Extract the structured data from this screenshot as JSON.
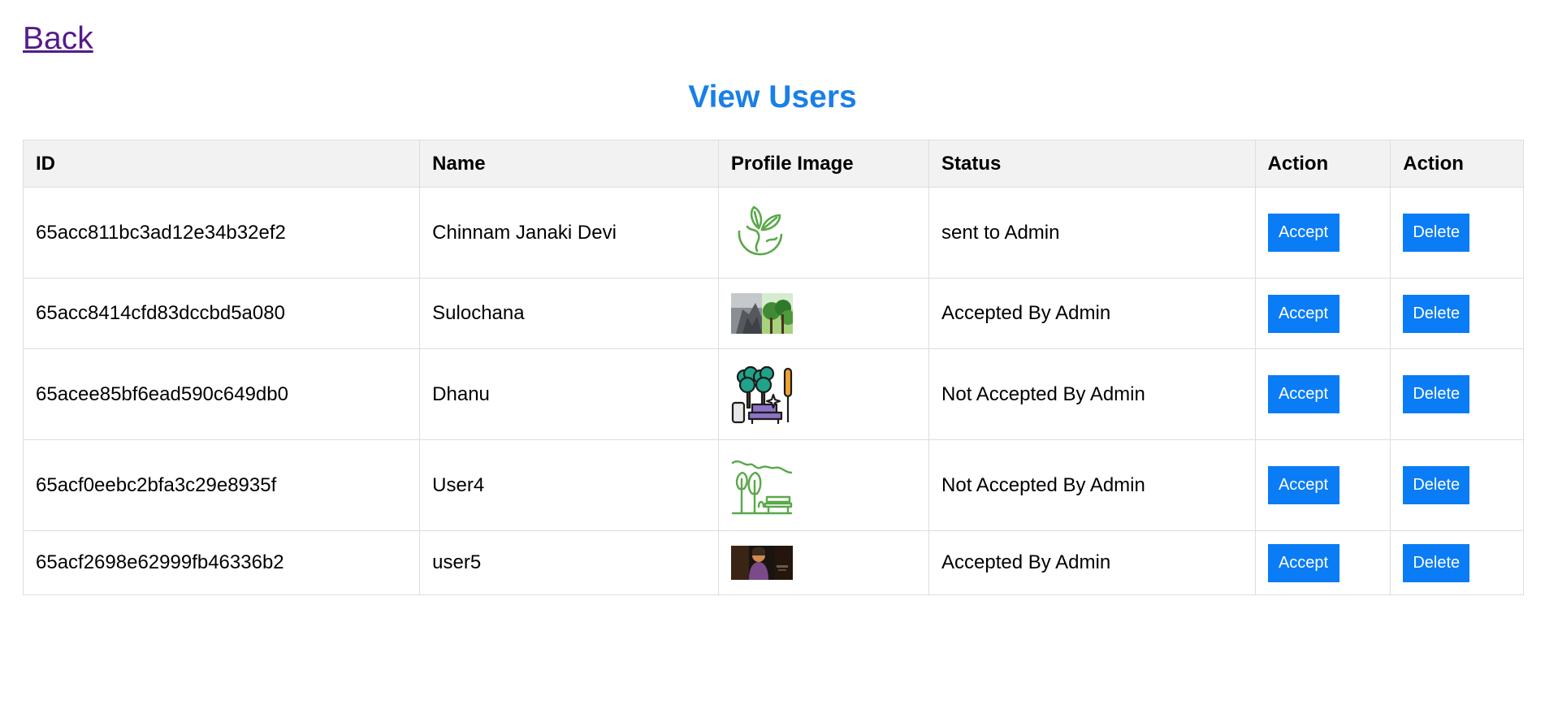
{
  "nav": {
    "back_label": "Back"
  },
  "page": {
    "title": "View Users"
  },
  "table": {
    "headers": [
      "ID",
      "Name",
      "Profile Image",
      "Status",
      "Action",
      "Action"
    ],
    "rows": [
      {
        "id": "65acc811bc3ad12e34b32ef2",
        "name": "Chinnam Janaki Devi",
        "image_icon": "eco-globe-leaves-icon",
        "status": "sent to Admin",
        "accept_label": "Accept",
        "delete_label": "Delete"
      },
      {
        "id": "65acc8414cfd83dccbd5a080",
        "name": "Sulochana",
        "image_icon": "nature-split-photo",
        "status": "Accepted By Admin",
        "accept_label": "Accept",
        "delete_label": "Delete"
      },
      {
        "id": "65acee85bf6ead590c649db0",
        "name": "Dhanu",
        "image_icon": "park-bench-trees-icon",
        "status": "Not Accepted By Admin",
        "accept_label": "Accept",
        "delete_label": "Delete"
      },
      {
        "id": "65acf0eebc2bfa3c29e8935f",
        "name": "User4",
        "image_icon": "park-outline-icon",
        "status": "Not Accepted By Admin",
        "accept_label": "Accept",
        "delete_label": "Delete"
      },
      {
        "id": "65acf2698e62999fb46336b2",
        "name": "user5",
        "image_icon": "portrait-dark-photo",
        "status": "Accepted By Admin",
        "accept_label": "Accept",
        "delete_label": "Delete"
      }
    ]
  },
  "colors": {
    "accent": "#0a7cf5",
    "title": "#1a7fe6",
    "link_visited": "#551a8b",
    "header_bg": "#f2f2f2",
    "border": "#dddddd"
  }
}
